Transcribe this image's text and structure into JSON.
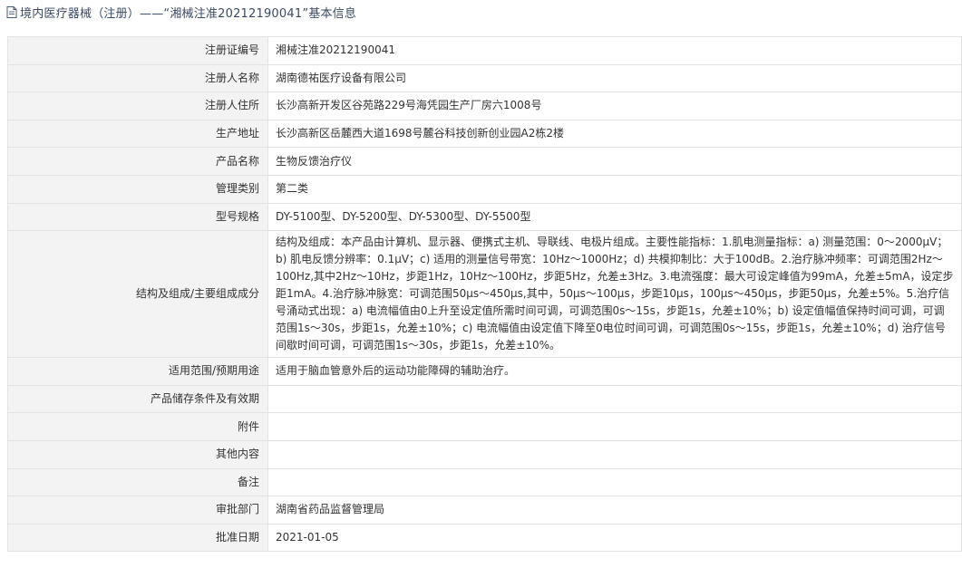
{
  "header": {
    "title": "境内医疗器械（注册）——“湘械注准20212190041”基本信息"
  },
  "rows": [
    {
      "label": "注册证编号",
      "value": "湘械注准20212190041"
    },
    {
      "label": "注册人名称",
      "value": "湖南德祐医疗设备有限公司"
    },
    {
      "label": "注册人住所",
      "value": "长沙高新开发区谷苑路229号海凭园生产厂房六1008号"
    },
    {
      "label": "生产地址",
      "value": "长沙高新区岳麓西大道1698号麓谷科技创新创业园A2栋2楼"
    },
    {
      "label": "产品名称",
      "value": "生物反馈治疗仪"
    },
    {
      "label": "管理类别",
      "value": "第二类"
    },
    {
      "label": "型号规格",
      "value": "DY-5100型、DY-5200型、DY-5300型、DY-5500型"
    },
    {
      "label": "结构及组成/主要组成成分",
      "value": "结构及组成：本产品由计算机、显示器、便携式主机、导联线、电极片组成。主要性能指标：1.肌电测量指标：a) 测量范围：0～2000μV；b) 肌电反馈分辨率：0.1μV；c) 适用的测量信号带宽：10Hz～1000Hz；d) 共模抑制比：大于100dB。2.治疗脉冲频率：可调范围2Hz～100Hz,其中2Hz～10Hz，步距1Hz，10Hz～100Hz，步距5Hz，允差±3Hz。3.电流强度：最大可设定峰值为99mA，允差±5mA，设定步距1mA。4.治疗脉冲脉宽：可调范围50μs～450μs,其中，50μs～100μs，步距10μs，100μs～450μs，步距50μs，允差±5%。5.治疗信号涌动式出现：a) 电流幅值由0上升至设定值所需时间可调，可调范围0s～15s，步距1s，允差±10%；b) 设定值幅值保持时间可调，可调范围1s～30s，步距1s，允差±10%；c) 电流幅值由设定值下降至0电位时间可调，可调范围0s～15s，步距1s，允差±10%；d) 治疗信号间歇时间可调，可调范围1s～30s，步距1s，允差±10%。"
    },
    {
      "label": "适用范围/预期用途",
      "value": "适用于脑血管意外后的运动功能障碍的辅助治疗。"
    },
    {
      "label": "产品储存条件及有效期",
      "value": ""
    },
    {
      "label": "附件",
      "value": ""
    },
    {
      "label": "其他内容",
      "value": ""
    },
    {
      "label": "备注",
      "value": ""
    },
    {
      "label": "审批部门",
      "value": "湖南省药品监督管理局"
    },
    {
      "label": "批准日期",
      "value": "2021-01-05"
    }
  ]
}
